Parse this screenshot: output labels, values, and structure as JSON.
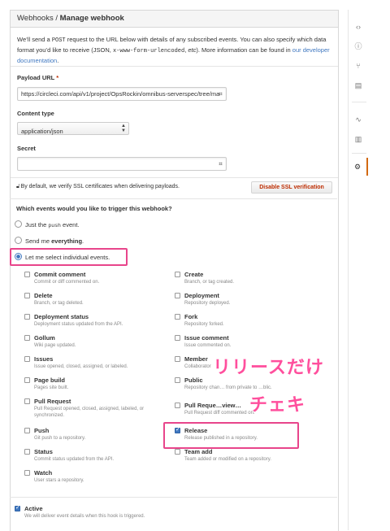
{
  "header": {
    "crumb_link": "Webhooks",
    "crumb_sep": " / ",
    "title": "Manage webhook"
  },
  "intro": {
    "p1": "We’ll send a ",
    "code1": "POST",
    "p2": " request to the URL below with details of any subscribed events. You can also specify which data format you’d like to receive (JSON, ",
    "code2": "x-www-form-urlencoded",
    "p3": ", ",
    "p3b": "etc",
    "p3c": "). More information can be found in ",
    "link": "our developer documentation",
    "p4": "."
  },
  "payload_url": {
    "label": "Payload URL ",
    "required": "*",
    "value": "https://circleci.com/api/v1/project/OpsRockin/omnibus-serverspec/tree/ma"
  },
  "content_type": {
    "label": "Content type",
    "value": "application/json"
  },
  "secret": {
    "label": "Secret",
    "value": ""
  },
  "ssl": {
    "note": "By default, we verify SSL certificates when delivering payloads.",
    "button": "Disable SSL verification"
  },
  "trigger": {
    "question": "Which events would you like to trigger this webhook?",
    "opt_push_pre": "Just the ",
    "opt_push_code": "push",
    "opt_push_post": " event.",
    "opt_all_pre": "Send me ",
    "opt_all_bold": "everything",
    "opt_all_post": ".",
    "opt_individual": "Let me select individual events."
  },
  "events_left": [
    {
      "name": "Commit comment",
      "desc": "Commit or diff commented on.",
      "checked": false
    },
    {
      "name": "Delete",
      "desc": "Branch, or tag deleted.",
      "checked": false
    },
    {
      "name": "Deployment status",
      "desc": "Deployment status updated from the API.",
      "checked": false
    },
    {
      "name": "Gollum",
      "desc": "Wiki page updated.",
      "checked": false
    },
    {
      "name": "Issues",
      "desc": "Issue opened, closed, assigned, or labeled.",
      "checked": false
    },
    {
      "name": "Page build",
      "desc": "Pages site built.",
      "checked": false
    },
    {
      "name": "Pull Request",
      "desc": "Pull Request opened, closed, assigned, labeled, or synchronized.",
      "checked": false
    },
    {
      "name": "Push",
      "desc": "Git push to a repository.",
      "checked": false
    },
    {
      "name": "Status",
      "desc": "Commit status updated from the API.",
      "checked": false
    },
    {
      "name": "Watch",
      "desc": "User stars a repository.",
      "checked": false
    }
  ],
  "events_right": [
    {
      "name": "Create",
      "desc": "Branch, or tag created.",
      "checked": false
    },
    {
      "name": "Deployment",
      "desc": "Repository deployed.",
      "checked": false
    },
    {
      "name": "Fork",
      "desc": "Repository forked.",
      "checked": false
    },
    {
      "name": "Issue comment",
      "desc": "Issue commented on.",
      "checked": false
    },
    {
      "name": "Member",
      "desc": "Collaborator",
      "checked": false
    },
    {
      "name": "Public",
      "desc": "Repository chan…  from private to …blic.",
      "checked": false
    },
    {
      "name": "Pull Reque…view…",
      "desc": "Pull Request diff commented on.",
      "checked": false
    },
    {
      "name": "Release",
      "desc": "Release published in a repository.",
      "checked": true
    },
    {
      "name": "Team add",
      "desc": "Team added or modified on a repository.",
      "checked": false
    }
  ],
  "active": {
    "label": "Active",
    "desc": "We will deliver event details when this hook is triggered.",
    "checked": true
  },
  "annotations": {
    "line1": "リリースだけ",
    "line2": "チェキ"
  },
  "rail_icons": [
    "code-icon",
    "issue-icon",
    "pull-request-icon",
    "wiki-icon",
    "pulse-icon",
    "graph-icon",
    "settings-icon"
  ],
  "colors": {
    "accent": "#4078c0",
    "danger": "#bd2c00",
    "highlight": "#e8458b",
    "overlay": "#ff4f9d"
  }
}
